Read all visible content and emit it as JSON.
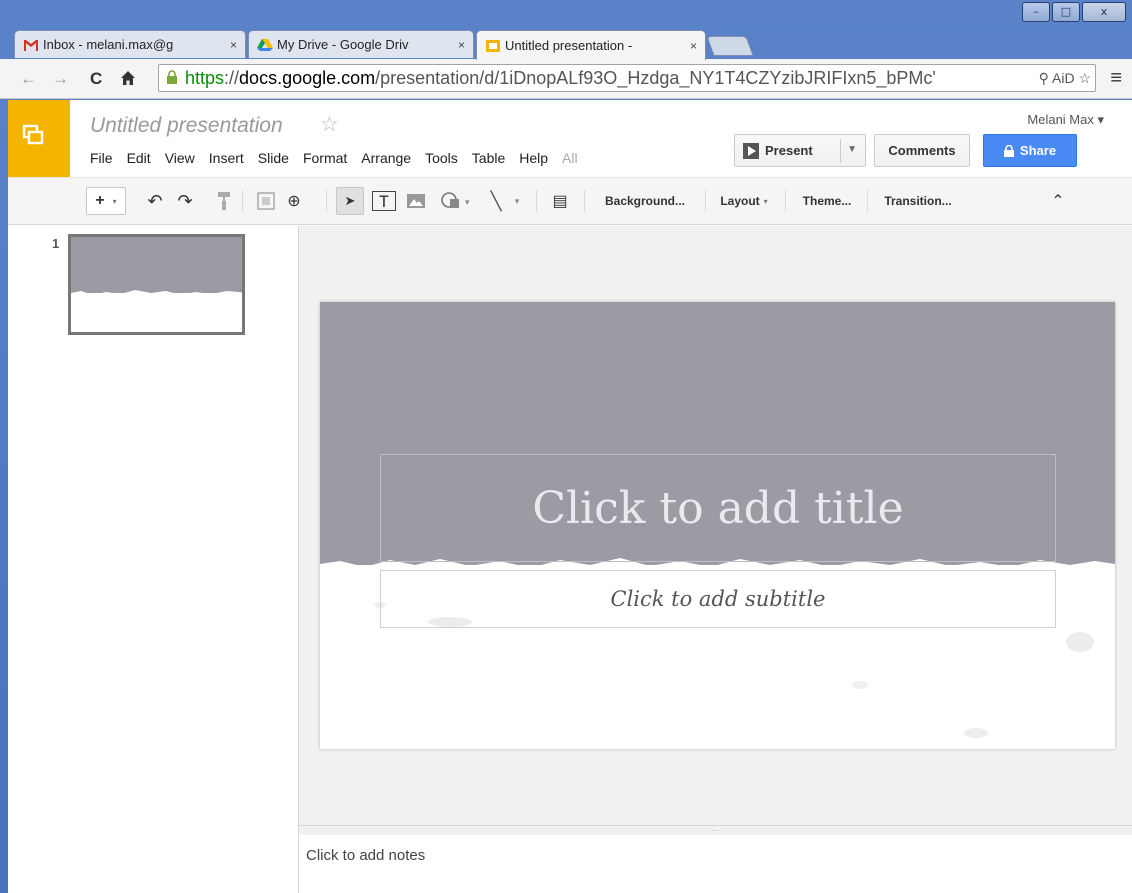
{
  "browser": {
    "tabs": [
      {
        "title": "Inbox - melani.max@g",
        "close": "×",
        "icon": "gmail-icon"
      },
      {
        "title": "My Drive - Google Driv",
        "close": "×",
        "icon": "drive-icon"
      },
      {
        "title": "Untitled presentation -",
        "close": "×",
        "icon": "slides-icon"
      }
    ],
    "window_controls": {
      "minimize": "–",
      "maximize": "□",
      "close": "x"
    },
    "url": {
      "scheme": "https",
      "sep": "://",
      "host": "docs.google.com",
      "path": "/presentation/d/1iDnopALf93O_Hzdga_NY1T4CZYzibJRIFIxn5_bPMc'"
    },
    "omnibox_icons": "⚲ AiD ☆",
    "nav": {
      "back": "←",
      "forward": "→",
      "reload": "C",
      "home": "🏠",
      "menu": "≡"
    }
  },
  "docs": {
    "title": "Untitled presentation",
    "star": "☆",
    "user": "Melani Max ▾",
    "menu": [
      "File",
      "Edit",
      "View",
      "Insert",
      "Slide",
      "Format",
      "Arrange",
      "Tools",
      "Table",
      "Help"
    ],
    "menu_extra": "All",
    "present_label": "Present",
    "comments_label": "Comments",
    "share_label": "Share",
    "toolbar": {
      "add": "+",
      "add_caret": "▾",
      "undo": "↶",
      "redo": "↷",
      "paint": "⚲",
      "zoom": "⊕",
      "select": "➤",
      "textbox": "T",
      "image": "▲",
      "shape": "◔",
      "line": "╲",
      "comment": "▤",
      "background": "Background...",
      "layout": "Layout",
      "layout_caret": "▾",
      "theme": "Theme...",
      "transition": "Transition...",
      "collapse": "⌃"
    },
    "slide_number": "1",
    "slide": {
      "title_placeholder": "Click to add title",
      "subtitle_placeholder": "Click to add subtitle"
    },
    "notes_handle": "...",
    "notes_placeholder": "Click to add notes"
  },
  "colors": {
    "accent_yellow": "#f4b400",
    "share_blue": "#4a8af4",
    "slide_band": "#9b9ba4"
  }
}
